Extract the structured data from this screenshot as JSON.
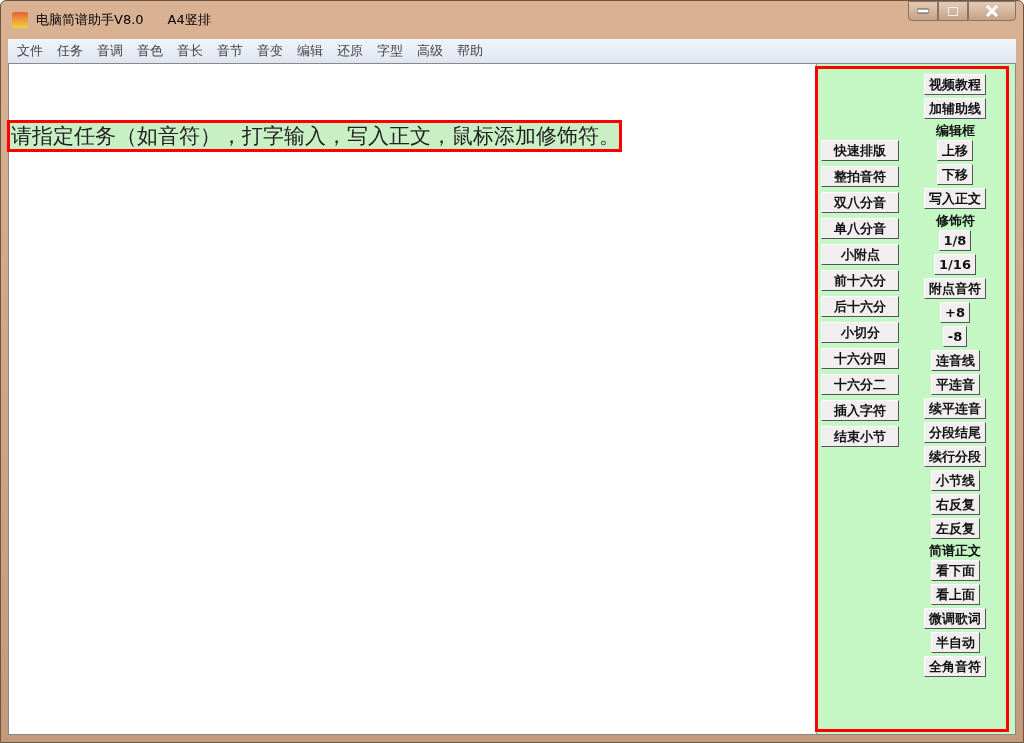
{
  "window": {
    "title": "电脑简谱助手V8.0",
    "subtitle": "A4竖排"
  },
  "menu": [
    "文件",
    "任务",
    "音调",
    "音色",
    "音长",
    "音节",
    "音变",
    "编辑",
    "还原",
    "字型",
    "高级",
    "帮助"
  ],
  "prompt": {
    "text": "请指定任务（如音符），打字输入，写入正文，鼠标添加修饰符。",
    "highlighted": true
  },
  "panel": {
    "highlighted": true,
    "left_column": [
      "快速排版",
      "整拍音符",
      "双八分音",
      "单八分音",
      "小附点",
      "前十六分",
      "后十六分",
      "小切分",
      "十六分四",
      "十六分二",
      "插入字符",
      "结束小节"
    ],
    "right_column": [
      {
        "kind": "button",
        "label": "视频教程"
      },
      {
        "kind": "button",
        "label": "加辅助线"
      },
      {
        "kind": "label",
        "label": "编辑框"
      },
      {
        "kind": "button",
        "label": "上移"
      },
      {
        "kind": "button",
        "label": "下移"
      },
      {
        "kind": "button",
        "label": "写入正文"
      },
      {
        "kind": "label",
        "label": "修饰符"
      },
      {
        "kind": "button",
        "label": "1/8"
      },
      {
        "kind": "button",
        "label": "1/16"
      },
      {
        "kind": "button",
        "label": "附点音符"
      },
      {
        "kind": "button",
        "label": "+8"
      },
      {
        "kind": "button",
        "label": "-8"
      },
      {
        "kind": "button",
        "label": "连音线"
      },
      {
        "kind": "button",
        "label": "平连音"
      },
      {
        "kind": "button",
        "label": "续平连音"
      },
      {
        "kind": "button",
        "label": "分段结尾"
      },
      {
        "kind": "button",
        "label": "续行分段"
      },
      {
        "kind": "button",
        "label": "小节线"
      },
      {
        "kind": "button",
        "label": "右反复"
      },
      {
        "kind": "button",
        "label": "左反复"
      },
      {
        "kind": "label",
        "label": "简谱正文"
      },
      {
        "kind": "button",
        "label": "看下面"
      },
      {
        "kind": "button",
        "label": "看上面"
      },
      {
        "kind": "button",
        "label": "微调歌词"
      },
      {
        "kind": "button",
        "label": "半自动"
      },
      {
        "kind": "button",
        "label": "全角音符"
      }
    ]
  }
}
